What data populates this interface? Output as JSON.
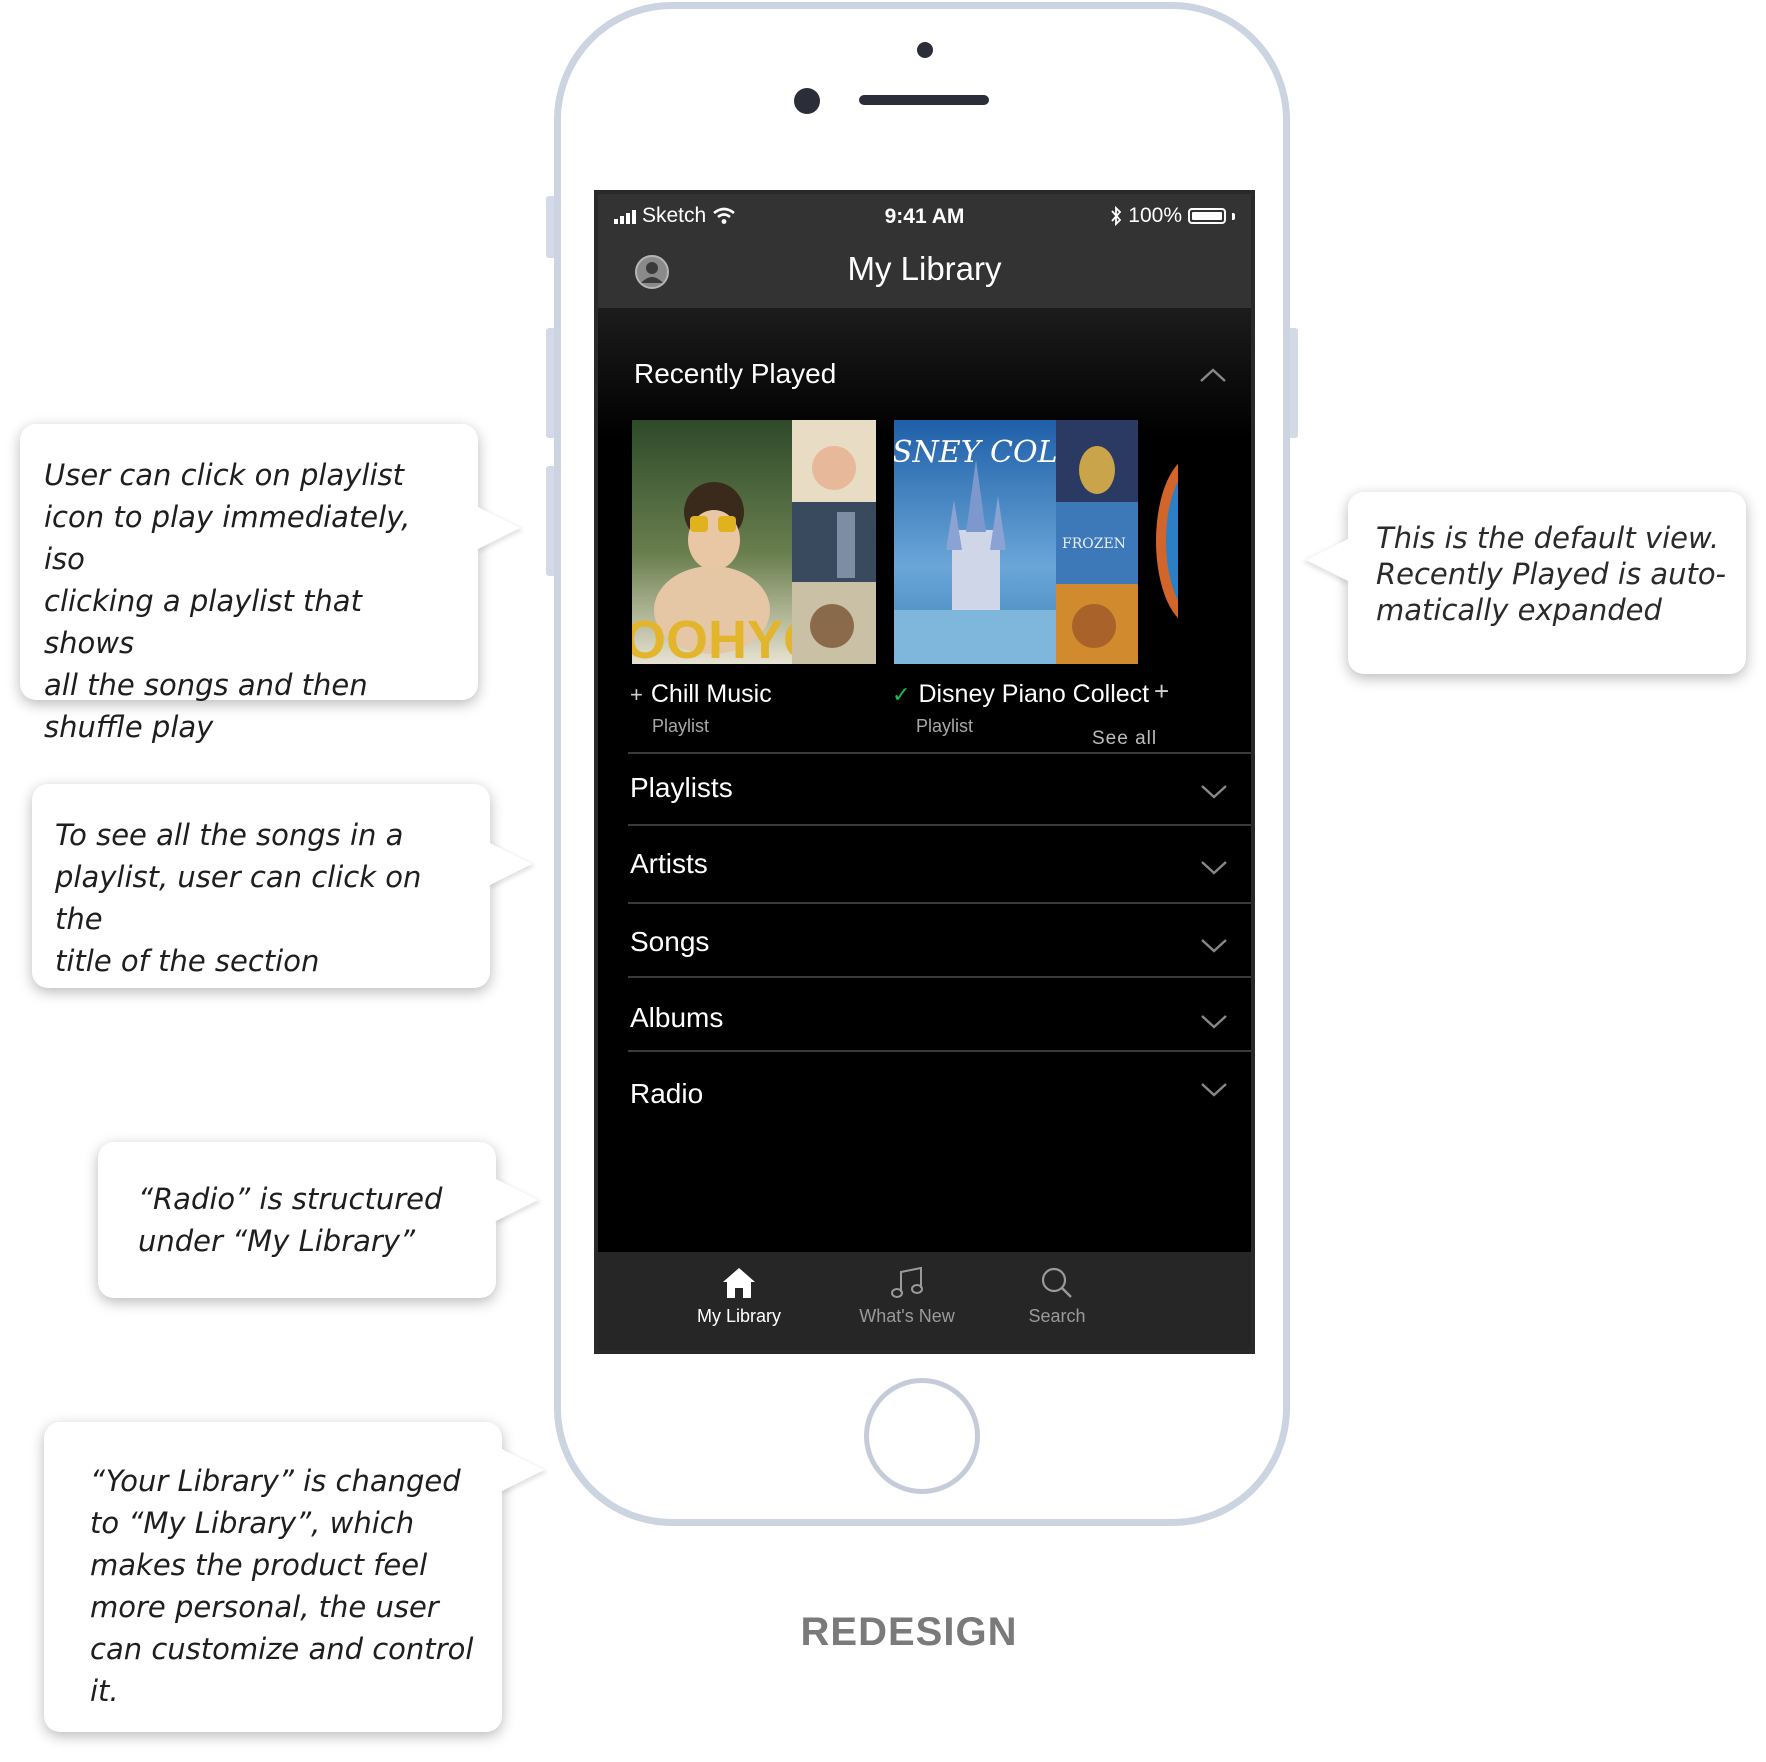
{
  "status_bar": {
    "carrier": "Sketch",
    "time": "9:41 AM",
    "battery": "100%"
  },
  "header": {
    "title": "My Library",
    "profile_icon": "profile-icon"
  },
  "recently_played": {
    "title": "Recently Played",
    "see_all": "See all",
    "items": [
      {
        "name": "Chill Music",
        "type": "Playlist",
        "mark": "+",
        "cover_text": "OOHYO"
      },
      {
        "name": "Disney Piano Collect",
        "type": "Playlist",
        "mark": "✓",
        "cover_text": "SNEY COLLE",
        "cover_sub": "FROZEN"
      }
    ],
    "add_mark": "+"
  },
  "sections": [
    {
      "label": "Playlists"
    },
    {
      "label": "Artists"
    },
    {
      "label": "Songs"
    },
    {
      "label": "Albums"
    },
    {
      "label": "Radio"
    }
  ],
  "tabs": [
    {
      "label": "My Library",
      "icon": "home-icon",
      "active": true
    },
    {
      "label": "What's New",
      "icon": "music-note-icon",
      "active": false
    },
    {
      "label": "Search",
      "icon": "search-icon",
      "active": false
    }
  ],
  "callouts": {
    "playlist_click": "User can click on playlist\nicon to play immediately, iso\nclicking a playlist that shows\nall the songs and then\nshuffle play",
    "section_title": "To see all the songs in a\nplaylist, user can click on the\ntitle of the section",
    "radio": "“Radio” is structured\nunder “My Library”",
    "library_rename": "“Your Library” is changed\nto “My Library”, which\nmakes the product feel\nmore personal, the user\ncan customize and control\nit.",
    "default_view": "This is the default view.\nRecently Played is auto-\nmatically expanded"
  },
  "caption": "REDESIGN",
  "colors": {
    "accent_green": "#1db954",
    "bar_bg": "#333333",
    "phone_frame": "#ccd3e1"
  }
}
